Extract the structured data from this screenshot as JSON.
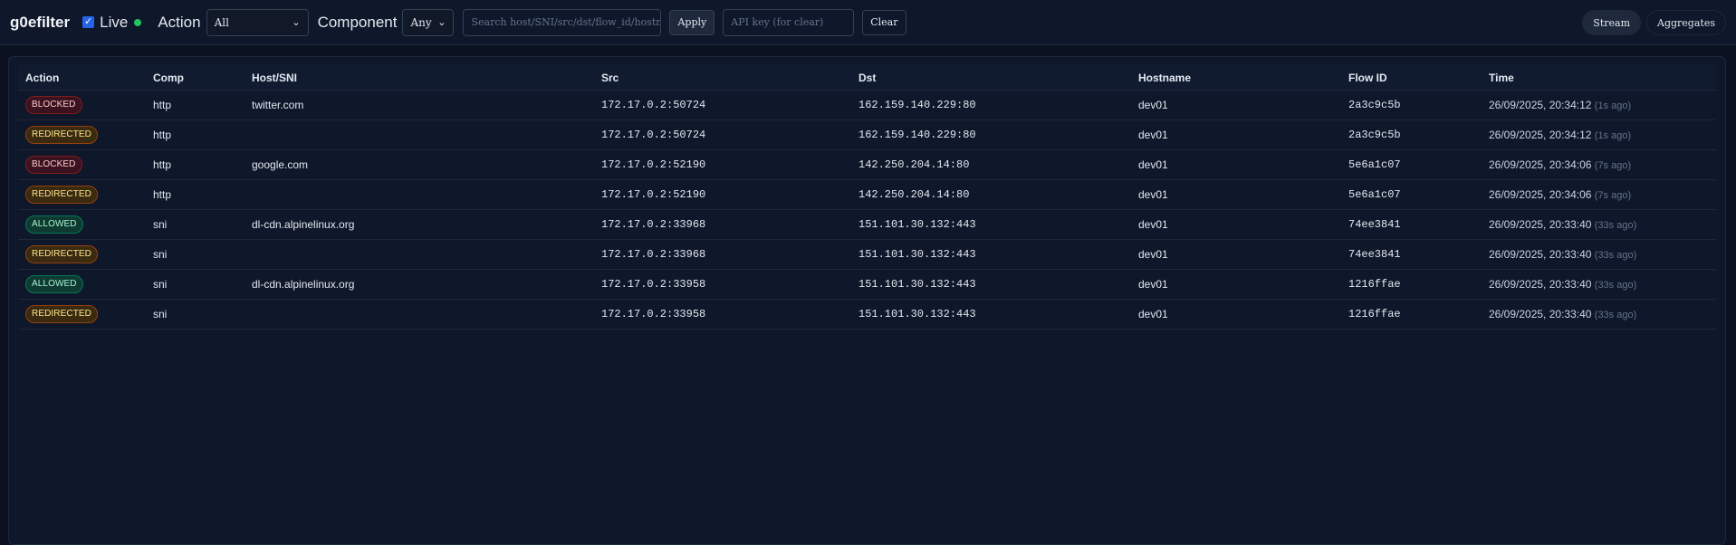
{
  "app": {
    "title": "g0efilter"
  },
  "filters": {
    "live_label": "Live",
    "live_checked": true,
    "action_label": "Action",
    "action_selected": "All",
    "component_label": "Component",
    "component_selected": "Any",
    "search_placeholder": "Search host/SNI/src/dst/flow_id/hostname",
    "apply_label": "Apply",
    "api_key_placeholder": "API key (for clear)",
    "clear_label": "Clear"
  },
  "view_tabs": {
    "stream_label": "Stream",
    "aggregates_label": "Aggregates",
    "active": "Stream"
  },
  "colors": {
    "accent": "#2563eb",
    "live_dot": "#22c55e",
    "blocked": "#fecaca",
    "redirected": "#fde68a",
    "allowed": "#a7f3d0"
  },
  "table": {
    "columns": [
      "Action",
      "Comp",
      "Host/SNI",
      "Src",
      "Dst",
      "Hostname",
      "Flow ID",
      "Time"
    ],
    "rows": [
      {
        "action": "BLOCKED",
        "action_kind": "blocked",
        "comp": "http",
        "host": "twitter.com",
        "src": "172.17.0.2:50724",
        "dst": "162.159.140.229:80",
        "hostname": "dev01",
        "flow_id": "2a3c9c5b",
        "time": "26/09/2025, 20:34:12",
        "ago": "(1s ago)"
      },
      {
        "action": "REDIRECTED",
        "action_kind": "redirected",
        "comp": "http",
        "host": "",
        "src": "172.17.0.2:50724",
        "dst": "162.159.140.229:80",
        "hostname": "dev01",
        "flow_id": "2a3c9c5b",
        "time": "26/09/2025, 20:34:12",
        "ago": "(1s ago)"
      },
      {
        "action": "BLOCKED",
        "action_kind": "blocked",
        "comp": "http",
        "host": "google.com",
        "src": "172.17.0.2:52190",
        "dst": "142.250.204.14:80",
        "hostname": "dev01",
        "flow_id": "5e6a1c07",
        "time": "26/09/2025, 20:34:06",
        "ago": "(7s ago)"
      },
      {
        "action": "REDIRECTED",
        "action_kind": "redirected",
        "comp": "http",
        "host": "",
        "src": "172.17.0.2:52190",
        "dst": "142.250.204.14:80",
        "hostname": "dev01",
        "flow_id": "5e6a1c07",
        "time": "26/09/2025, 20:34:06",
        "ago": "(7s ago)"
      },
      {
        "action": "ALLOWED",
        "action_kind": "allowed",
        "comp": "sni",
        "host": "dl-cdn.alpinelinux.org",
        "src": "172.17.0.2:33968",
        "dst": "151.101.30.132:443",
        "hostname": "dev01",
        "flow_id": "74ee3841",
        "time": "26/09/2025, 20:33:40",
        "ago": "(33s ago)"
      },
      {
        "action": "REDIRECTED",
        "action_kind": "redirected",
        "comp": "sni",
        "host": "",
        "src": "172.17.0.2:33968",
        "dst": "151.101.30.132:443",
        "hostname": "dev01",
        "flow_id": "74ee3841",
        "time": "26/09/2025, 20:33:40",
        "ago": "(33s ago)"
      },
      {
        "action": "ALLOWED",
        "action_kind": "allowed",
        "comp": "sni",
        "host": "dl-cdn.alpinelinux.org",
        "src": "172.17.0.2:33958",
        "dst": "151.101.30.132:443",
        "hostname": "dev01",
        "flow_id": "1216ffae",
        "time": "26/09/2025, 20:33:40",
        "ago": "(33s ago)"
      },
      {
        "action": "REDIRECTED",
        "action_kind": "redirected",
        "comp": "sni",
        "host": "",
        "src": "172.17.0.2:33958",
        "dst": "151.101.30.132:443",
        "hostname": "dev01",
        "flow_id": "1216ffae",
        "time": "26/09/2025, 20:33:40",
        "ago": "(33s ago)"
      }
    ]
  }
}
